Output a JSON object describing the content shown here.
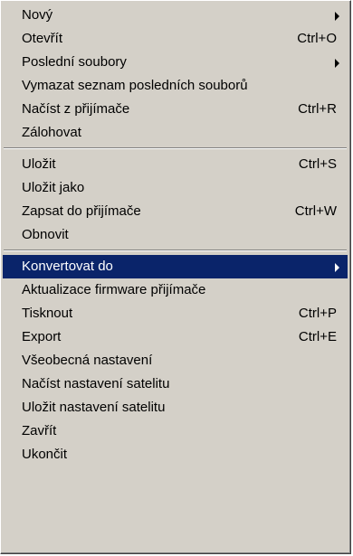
{
  "menu": {
    "groups": [
      [
        {
          "label": "Nový",
          "shortcut": "",
          "submenu": true
        },
        {
          "label": "Otevřít",
          "shortcut": "Ctrl+O",
          "submenu": false
        },
        {
          "label": "Poslední soubory",
          "shortcut": "",
          "submenu": true
        },
        {
          "label": "Vymazat seznam posledních souborů",
          "shortcut": "",
          "submenu": false
        },
        {
          "label": "Načíst z přijímače",
          "shortcut": "Ctrl+R",
          "submenu": false
        },
        {
          "label": "Zálohovat",
          "shortcut": "",
          "submenu": false
        }
      ],
      [
        {
          "label": "Uložit",
          "shortcut": "Ctrl+S",
          "submenu": false
        },
        {
          "label": "Uložit jako",
          "shortcut": "",
          "submenu": false
        },
        {
          "label": "Zapsat do přijímače",
          "shortcut": "Ctrl+W",
          "submenu": false
        },
        {
          "label": "Obnovit",
          "shortcut": "",
          "submenu": false
        }
      ],
      [
        {
          "label": "Konvertovat do",
          "shortcut": "",
          "submenu": true,
          "selected": true
        },
        {
          "label": "Aktualizace firmware přijímače",
          "shortcut": "",
          "submenu": false
        },
        {
          "label": "Tisknout",
          "shortcut": "Ctrl+P",
          "submenu": false
        },
        {
          "label": "Export",
          "shortcut": "Ctrl+E",
          "submenu": false
        },
        {
          "label": "Všeobecná nastavení",
          "shortcut": "",
          "submenu": false
        },
        {
          "label": "Načíst nastavení satelitu",
          "shortcut": "",
          "submenu": false
        },
        {
          "label": "Uložit nastavení satelitu",
          "shortcut": "",
          "submenu": false
        },
        {
          "label": "Zavřít",
          "shortcut": "",
          "submenu": false
        },
        {
          "label": "Ukončit",
          "shortcut": "",
          "submenu": false
        }
      ]
    ],
    "colors": {
      "background": "#d4d0c8",
      "highlight": "#0a246a",
      "highlight_text": "#ffffff",
      "text": "#000000"
    }
  }
}
